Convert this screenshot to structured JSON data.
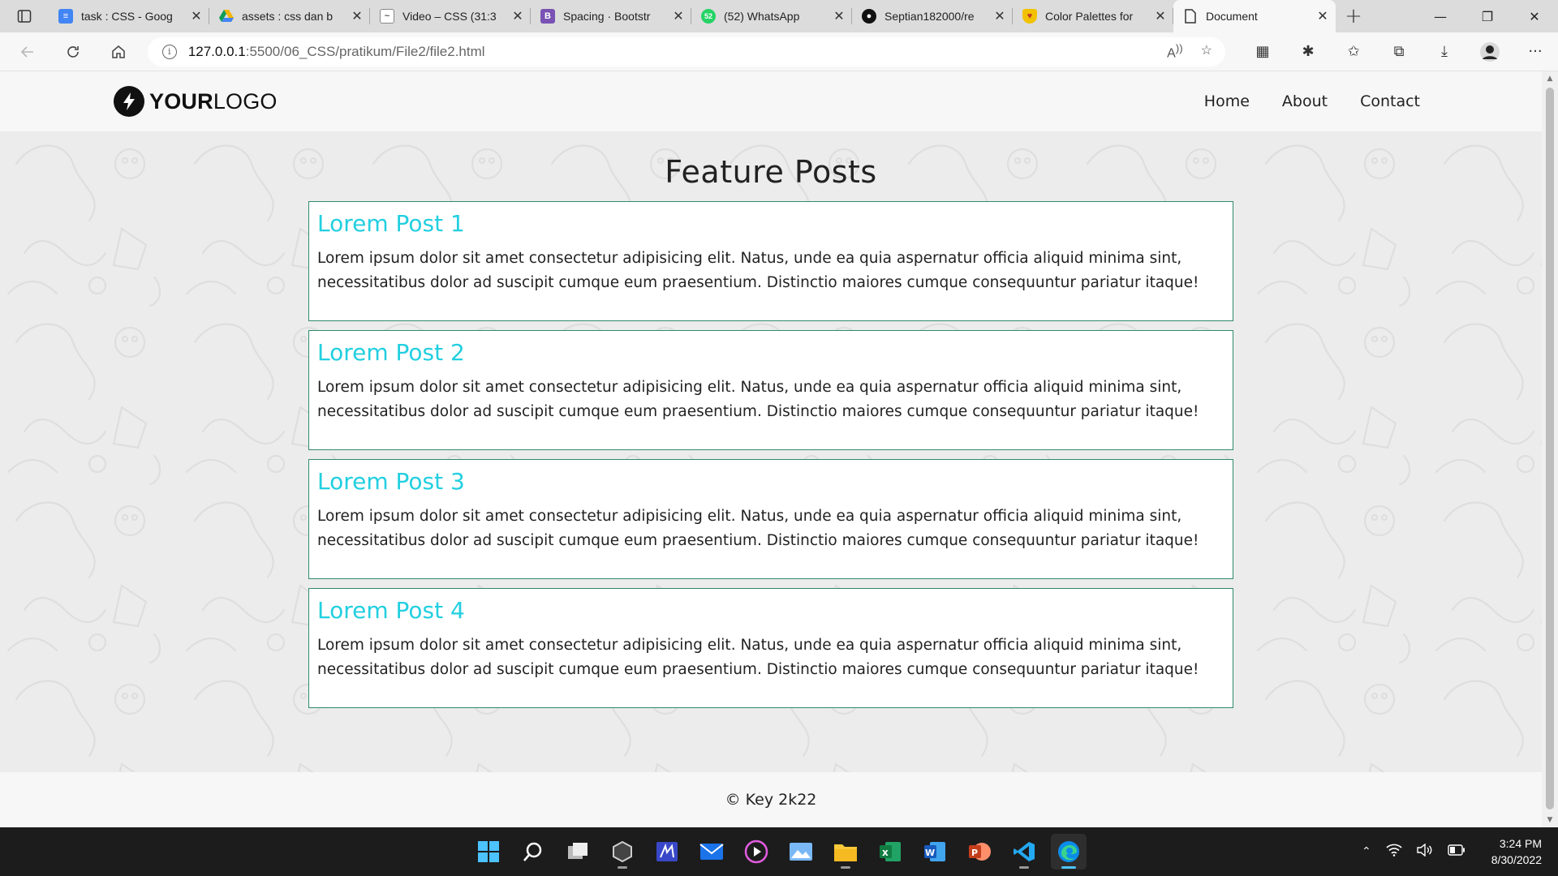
{
  "browser": {
    "tabs": [
      {
        "title": "task : CSS - Goog",
        "favicon": "google-docs-icon",
        "color": "#4285f4"
      },
      {
        "title": "assets : css dan b",
        "favicon": "google-drive-icon",
        "color": "#f4b400"
      },
      {
        "title": "Video – CSS (31:3",
        "favicon": "video-icon",
        "color": "#ffffff"
      },
      {
        "title": "Spacing · Bootstr",
        "favicon": "bootstrap-icon",
        "color": "#7952b3"
      },
      {
        "title": "(52) WhatsApp",
        "favicon": "whatsapp-icon",
        "color": "#25d366"
      },
      {
        "title": "Septian182000/re",
        "favicon": "github-icon",
        "color": "#111111"
      },
      {
        "title": "Color Palettes for",
        "favicon": "palette-icon",
        "color": "#e64a3c"
      },
      {
        "title": "Document",
        "favicon": "document-icon",
        "color": "#ffffff",
        "active": true
      }
    ],
    "address": {
      "host": "127.0.0.1",
      "path": ":5500/06_CSS/pratikum/File2/file2.html"
    }
  },
  "site": {
    "logo": {
      "bold": "YOUR",
      "light": "LOGO"
    },
    "nav": [
      "Home",
      "About",
      "Contact"
    ],
    "title": "Feature Posts",
    "posts": [
      {
        "title": "Lorem Post 1",
        "body": "Lorem ipsum dolor sit amet consectetur adipisicing elit. Natus, unde ea quia aspernatur officia aliquid minima sint, necessitatibus dolor ad suscipit cumque eum praesentium. Distinctio maiores cumque consequuntur pariatur itaque!"
      },
      {
        "title": "Lorem Post 2",
        "body": "Lorem ipsum dolor sit amet consectetur adipisicing elit. Natus, unde ea quia aspernatur officia aliquid minima sint, necessitatibus dolor ad suscipit cumque eum praesentium. Distinctio maiores cumque consequuntur pariatur itaque!"
      },
      {
        "title": "Lorem Post 3",
        "body": "Lorem ipsum dolor sit amet consectetur adipisicing elit. Natus, unde ea quia aspernatur officia aliquid minima sint, necessitatibus dolor ad suscipit cumque eum praesentium. Distinctio maiores cumque consequuntur pariatur itaque!"
      },
      {
        "title": "Lorem Post 4",
        "body": "Lorem ipsum dolor sit amet consectetur adipisicing elit. Natus, unde ea quia aspernatur officia aliquid minima sint, necessitatibus dolor ad suscipit cumque eum praesentium. Distinctio maiores cumque consequuntur pariatur itaque!"
      }
    ],
    "footer": "© Key 2k22",
    "colors": {
      "post_title": "#22cfe0",
      "card_border": "#2f8a69"
    }
  },
  "taskbar": {
    "apps": [
      "windows-start-icon",
      "search-icon",
      "task-view-icon",
      "app-icon",
      "app-icon",
      "mail-icon",
      "media-player-icon",
      "photos-icon",
      "file-explorer-icon",
      "excel-icon",
      "word-icon",
      "powerpoint-icon",
      "vscode-icon",
      "edge-icon"
    ],
    "time": "3:24 PM",
    "date": "8/30/2022"
  }
}
